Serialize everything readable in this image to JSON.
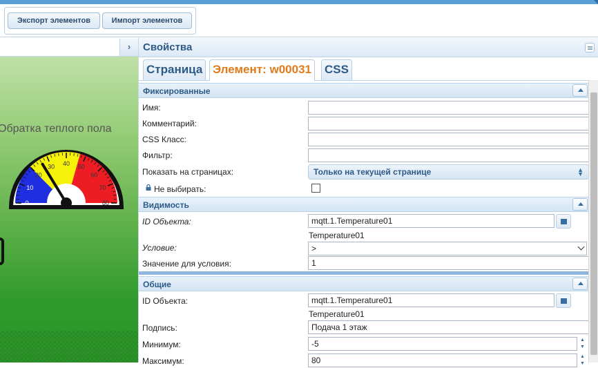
{
  "toolbar": {
    "export_label": "Экспорт элементов",
    "import_label": "Импорт элементов"
  },
  "left_panel": {
    "collapse_icon": "chevron-right-icon",
    "collapse_glyph": "›"
  },
  "gauge": {
    "title": "Обратка теплого пола",
    "min": 0,
    "max": 80,
    "tick_labels": [
      "0",
      "10",
      "20",
      "30",
      "40",
      "50",
      "60",
      "70",
      "80"
    ],
    "value": 26,
    "bands": [
      {
        "from": 0,
        "to": 20,
        "color": "#1f2fe0"
      },
      {
        "from": 20,
        "to": 47,
        "color": "#f7f20a"
      },
      {
        "from": 47,
        "to": 80,
        "color": "#ee1d24"
      }
    ]
  },
  "properties": {
    "title": "Свойства",
    "tabs": [
      {
        "label": "Страница",
        "active": false
      },
      {
        "label": "Элемент: w00031",
        "active": true
      },
      {
        "label": "CSS",
        "active": false
      }
    ],
    "fixed": {
      "header": "Фиксированные",
      "name_label": "Имя:",
      "name_value": "",
      "comment_label": "Комментарий:",
      "comment_value": "",
      "css_class_label": "CSS Класс:",
      "css_class_value": "",
      "filter_label": "Фильтр:",
      "filter_value": "",
      "show_on_pages_label": "Показать на страницах:",
      "show_on_pages_value": "Только на текущей странице",
      "no_select_label": "Не выбирать:",
      "no_select_checked": false
    },
    "visibility": {
      "header": "Видимость",
      "object_id_label": "ID Объекта:",
      "object_id_value": "mqtt.1.Temperature01",
      "object_id_name": "Temperature01",
      "condition_label": "Условие:",
      "condition_value": ">",
      "condition_value_label": "Значение для условия:",
      "condition_value_value": "1"
    },
    "common": {
      "header": "Общие",
      "object_id_label": "ID Объекта:",
      "object_id_value": "mqtt.1.Temperature01",
      "object_id_name": "Temperature01",
      "caption_label": "Подпись:",
      "caption_value": "Подача 1 этаж",
      "min_label": "Минимум:",
      "min_value": "-5",
      "max_label": "Максимум:",
      "max_value": "80"
    }
  },
  "colors": {
    "accent_blue": "#2d5a86",
    "active_tab": "#e07a1a",
    "canvas_green": "#2f9a2c"
  }
}
